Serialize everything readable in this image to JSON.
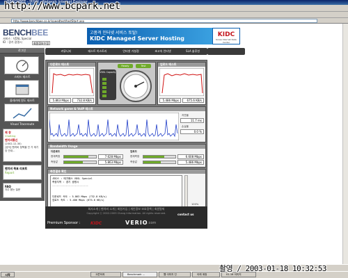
{
  "window": {
    "title": "BENCHBEE - 벤치비 - Network Internet Explorer",
    "watermark": "http://www.bcpark.net"
  },
  "browser": {
    "address": "http://www.benchbee.co.kr/speedtest/testStart.asp"
  },
  "header": {
    "logo_main": "BENCH",
    "logo_accent": "BEE",
    "service_line": "서비스 : VDSL Special",
    "user_line": "ID : 경기 광명시",
    "edit_user_label": "회원정보수정"
  },
  "banner": {
    "line1": "고품격 인터넷 서비스 토탈!",
    "line2": "KIDC Managed Server Hosting",
    "kidc": "KIDC",
    "kidc_sub": "Korea Internet Data Center"
  },
  "nav": {
    "items": [
      "커뮤니티",
      "테스트 히스토리",
      "인터넷 가설정",
      "초고속 인터넷",
      "SLA 솔루션"
    ]
  },
  "sidebar": {
    "login_label": "로그인",
    "items": [
      {
        "label": "스피드 테스트"
      },
      {
        "label": "몰래카메 원도 테스트"
      },
      {
        "label": "Visual Traceroute"
      }
    ],
    "notice_title": "제 창",
    "notice_sub": "Chatting",
    "notice_label": "벤치비통신",
    "notice_date": "(2002-12-30)",
    "notice_text": "[공지] 벤치비 정책을 인 가 재기당 안내...",
    "report_title": "벤치비 목표 리포트",
    "report_sub": "Report",
    "faq_title": "FAQ",
    "faq_sub": "자주 묻는 질문"
  },
  "test": {
    "download_title": "다운로드 테스트",
    "upload_title": "업로드 테스트",
    "download_speed": "5.863 Mbps",
    "download_kb": "732.8 KB/s",
    "upload_speed": "5.486 Mbps",
    "upload_kb": "675.6 KB/s",
    "capacity_label": "VDSL Capacity",
    "status_ready": "Ready",
    "status_test": "Test",
    "graph_title": "Network game & VoIP 테스트",
    "delay_label": "지연율",
    "delay_value": "11.7 ms",
    "loss_label": "손실율",
    "loss_value": "0.0 %",
    "usage_title": "Bandwidth Usage",
    "dl_section": "다운로드",
    "ul_section": "업로드",
    "current_label": "현재측정",
    "avg_label": "측정값",
    "dl_current": "7.628 Mbps",
    "dl_avg": "5.863 Mbps",
    "ul_current": "6.608 Mbps",
    "ul_avg": "5.486 Mbps",
    "result_title": "측정결과 확인",
    "result_lines": [
      "서비스 : 메가패스 VDSL Special",
      "측정지역 : 경기 광명시",
      "------------------------",
      "다운로드 속도 : 5.863 Mbps (732.8 KB/s)",
      "업로드 속도 : 5.486 Mbps (675.6 KB/s)"
    ],
    "percentage": "100%"
  },
  "footer": {
    "links": "회사소개 | 벤치비 소개 | 회원가입 | 개인정보 보호정책 | 회원탈퇴",
    "copyright": "Copyright ⓒ 2002-2003 Chang Information. All rights reserved.",
    "sponsor_label": "Premium Sponsor :",
    "kidc_logo": "KIDC",
    "verio": "VERIO",
    "verio_tld": ".com",
    "contact": "contact us"
  },
  "taskbar": {
    "start": "시작",
    "buttons": [
      "고른하게",
      "Benchmark ...",
      "웹 이미지 인",
      "이래 계정",
      "01-18 이미지"
    ]
  },
  "timestamp": "촬영 / 2003-01-18 10:32:53",
  "colors": {
    "accent_green": "#6faa2a",
    "graph_blue": "#1e3cc8",
    "graph_red": "#d01010",
    "panel_dark": "#3a3a3a"
  }
}
